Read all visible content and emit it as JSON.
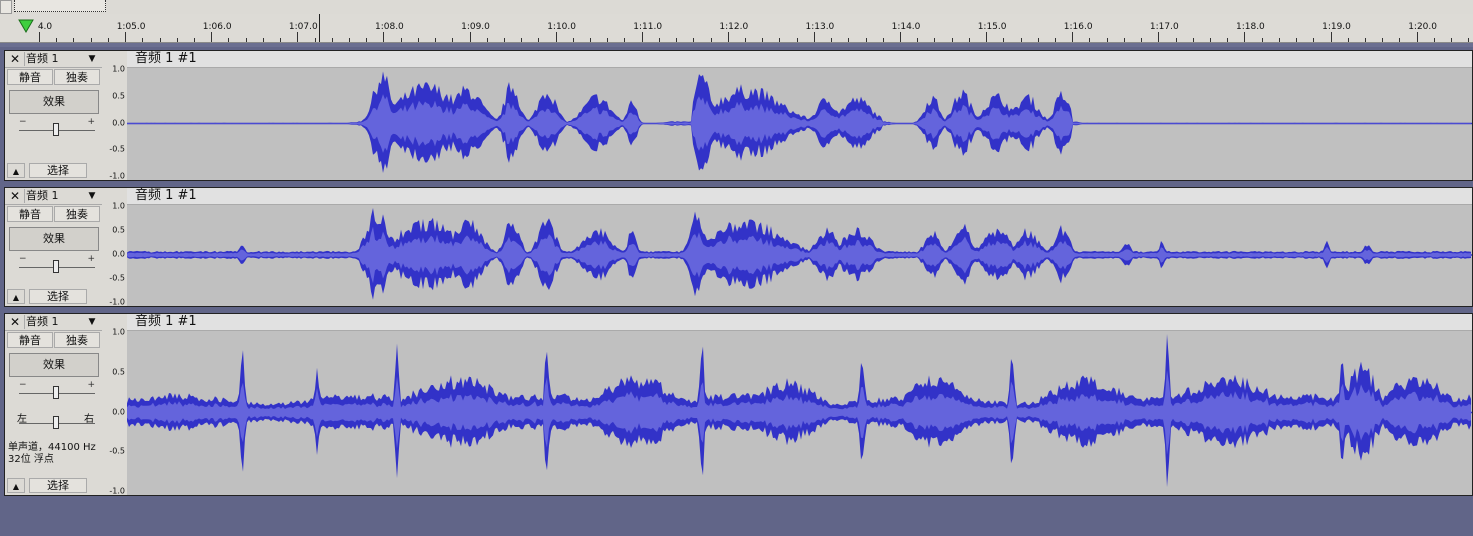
{
  "ruler": {
    "labels": [
      "4.0",
      "1:05.0",
      "1:06.0",
      "1:07.0",
      "1:08.0",
      "1:09.0",
      "1:10.0",
      "1:11.0",
      "1:12.0",
      "1:13.0",
      "1:14.0",
      "1:15.0",
      "1:16.0",
      "1:17.0",
      "1:18.0",
      "1:19.0",
      "1:20.0"
    ]
  },
  "tracks": [
    {
      "name": "音频 1",
      "close": "✕",
      "dropdown": "▼",
      "mute": "静音",
      "solo": "独奏",
      "effect": "效果",
      "gain_minus": "−",
      "gain_plus": "+",
      "collapse": "▲",
      "select": "选择",
      "clip_name": "音频 1 #1",
      "scale": [
        "1.0",
        "0.5",
        "0.0",
        "-0.5",
        "-1.0"
      ]
    },
    {
      "name": "音频 1",
      "close": "✕",
      "dropdown": "▼",
      "mute": "静音",
      "solo": "独奏",
      "effect": "效果",
      "gain_minus": "−",
      "gain_plus": "+",
      "collapse": "▲",
      "select": "选择",
      "clip_name": "音频 1 #1",
      "scale": [
        "1.0",
        "0.5",
        "0.0",
        "-0.5",
        "-1.0"
      ]
    },
    {
      "name": "音频 1",
      "close": "✕",
      "dropdown": "▼",
      "mute": "静音",
      "solo": "独奏",
      "effect": "效果",
      "gain_minus": "−",
      "gain_plus": "+",
      "pan_left": "左",
      "pan_right": "右",
      "info_line1": "单声道，44100 Hz",
      "info_line2": "32位 浮点",
      "collapse": "▲",
      "select": "选择",
      "clip_name": "音频 1 #1",
      "scale": [
        "1.0",
        "0.5",
        "0.0",
        "-0.5",
        "-1.0"
      ]
    }
  ],
  "colors": {
    "waveform": "#3232c8",
    "waveform_rms": "#6464dc",
    "background": "#616588"
  }
}
